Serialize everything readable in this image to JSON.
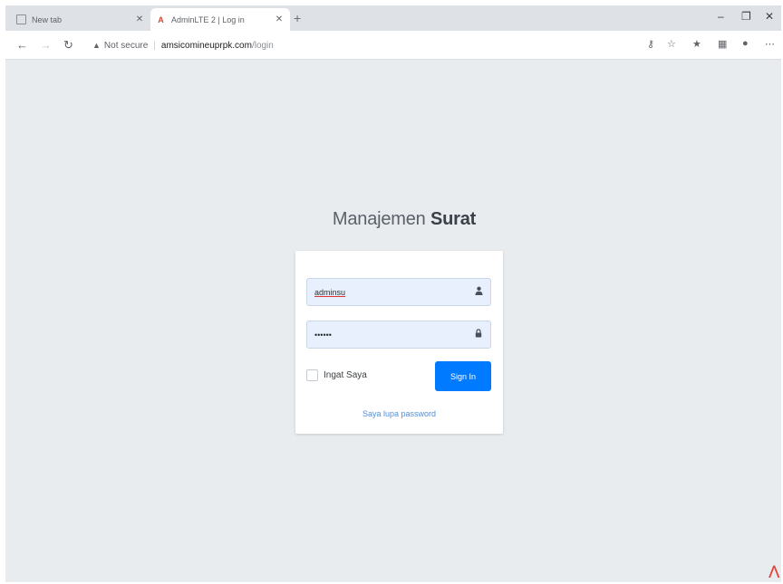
{
  "browser": {
    "tabs": [
      {
        "title": "New tab",
        "active": false
      },
      {
        "title": "AdminLTE 2 | Log in",
        "active": true
      }
    ],
    "new_tab_glyph": "+",
    "window": {
      "minimize": "–",
      "restore": "❐",
      "close": "✕"
    },
    "address": {
      "security_label": "Not secure",
      "host": "amsicomineuprpk.com",
      "path": "/login"
    },
    "icons": [
      "back-icon",
      "forward-icon",
      "refresh-icon",
      "key-icon",
      "star-icon",
      "favorites-icon",
      "collections-icon",
      "profile-icon",
      "more-icon"
    ]
  },
  "login": {
    "logo_light": "Manajemen ",
    "logo_bold": "Surat",
    "username_value": "adminsu",
    "password_value": "••••••",
    "remember_label": "Ingat Saya",
    "signin_label": "Sign In",
    "forgot_label": "Saya lupa password"
  },
  "colors": {
    "accent": "#007bff",
    "background": "#e9ecef",
    "input_fill": "#e8f0fe"
  }
}
